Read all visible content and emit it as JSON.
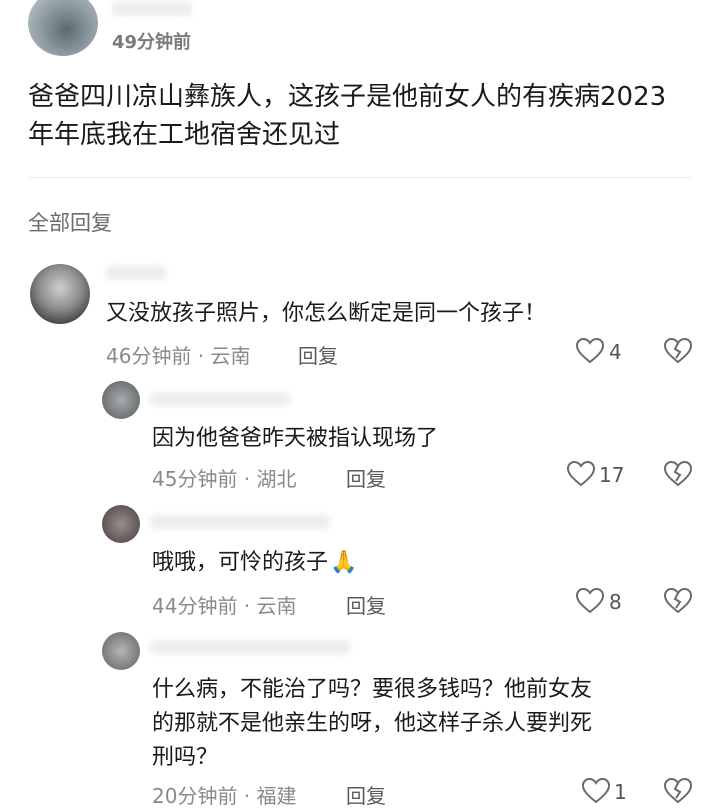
{
  "post": {
    "time": "49分钟前",
    "text_line1": "爸爸四川凉山彝族人，这孩子是他前女人的有疾病2023",
    "text_line2": "年年底我在工地宿舍还见过"
  },
  "replies_header": "全部回复",
  "comments": [
    {
      "text": "又没放孩子照片，你怎么断定是同一个孩子！",
      "meta": "46分钟前 · 云南",
      "reply": "回复",
      "likes": "4"
    },
    {
      "text": "因为他爸爸昨天被指认现场了",
      "meta": "45分钟前 · 湖北",
      "reply": "回复",
      "likes": "17"
    },
    {
      "text": "哦哦，可怜的孩子",
      "emoji": "🙏",
      "meta": "44分钟前 · 云南",
      "reply": "回复",
      "likes": "8"
    },
    {
      "lines": [
        "什么病，不能治了吗？要很多钱吗？他前女友",
        "的那就不是他亲生的呀，他这样子杀人要判死",
        "刑吗？"
      ],
      "meta": "20分钟前 · 福建",
      "reply": "回复",
      "likes": "1"
    }
  ],
  "icons": {
    "like": "heart-icon",
    "dislike": "broken-heart-icon"
  }
}
